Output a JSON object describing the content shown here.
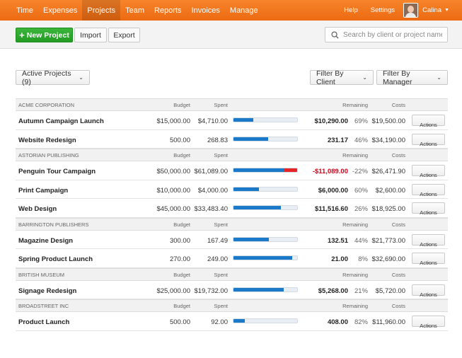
{
  "nav": {
    "items": [
      {
        "label": "Time",
        "active": false
      },
      {
        "label": "Expenses",
        "active": false
      },
      {
        "label": "Projects",
        "active": true
      },
      {
        "label": "Team",
        "active": false
      },
      {
        "label": "Reports",
        "active": false
      },
      {
        "label": "Invoices",
        "active": false
      },
      {
        "label": "Manage",
        "active": false
      }
    ],
    "help": "Help",
    "settings": "Settings",
    "user": "Calina"
  },
  "toolbar": {
    "new_project": "New Project",
    "import": "Import",
    "export": "Export",
    "search_placeholder": "Search by client or project name"
  },
  "filters": {
    "active": "Active Projects (9)",
    "client": "Filter By Client",
    "manager": "Filter By Manager"
  },
  "headers": {
    "budget": "Budget",
    "spent": "Spent",
    "remaining": "Remaining",
    "costs": "Costs"
  },
  "action_label": "Actions",
  "colors": {
    "nav": "#ec6a12",
    "new_button": "#249c24",
    "progress": "#1a7ac9",
    "over_budget": "#e8242b"
  },
  "groups": [
    {
      "client": "Acme Corporation",
      "projects": [
        {
          "name": "Autumn Campaign Launch",
          "budget": "$15,000.00",
          "spent": "$4,710.00",
          "progress": 0.31,
          "over": 0,
          "remaining": "$10,290.00",
          "pct": "69%",
          "costs": "$19,500.00",
          "negative": false
        },
        {
          "name": "Website Redesign",
          "budget": "500.00",
          "spent": "268.83",
          "progress": 0.54,
          "over": 0,
          "remaining": "231.17",
          "pct": "46%",
          "costs": "$34,190.00",
          "negative": false
        }
      ]
    },
    {
      "client": "Astorian Publishing",
      "projects": [
        {
          "name": "Penguin Tour Campaign",
          "budget": "$50,000.00",
          "spent": "$61,089.00",
          "progress": 0.8,
          "over": 0.2,
          "remaining": "-$11,089.00",
          "pct": "-22%",
          "costs": "$26,471.90",
          "negative": true
        },
        {
          "name": "Print Campaign",
          "budget": "$10,000.00",
          "spent": "$4,000.00",
          "progress": 0.4,
          "over": 0,
          "remaining": "$6,000.00",
          "pct": "60%",
          "costs": "$2,600.00",
          "negative": false
        },
        {
          "name": "Web Design",
          "budget": "$45,000.00",
          "spent": "$33,483.40",
          "progress": 0.74,
          "over": 0,
          "remaining": "$11,516.60",
          "pct": "26%",
          "costs": "$18,925.00",
          "negative": false
        }
      ]
    },
    {
      "client": "Barrington Publishers",
      "projects": [
        {
          "name": "Magazine Design",
          "budget": "300.00",
          "spent": "167.49",
          "progress": 0.56,
          "over": 0,
          "remaining": "132.51",
          "pct": "44%",
          "costs": "$21,773.00",
          "negative": false
        },
        {
          "name": "Spring Product Launch",
          "budget": "270.00",
          "spent": "249.00",
          "progress": 0.92,
          "over": 0,
          "remaining": "21.00",
          "pct": "8%",
          "costs": "$32,690.00",
          "negative": false
        }
      ]
    },
    {
      "client": "British Museum",
      "projects": [
        {
          "name": "Signage Redesign",
          "budget": "$25,000.00",
          "spent": "$19,732.00",
          "progress": 0.79,
          "over": 0,
          "remaining": "$5,268.00",
          "pct": "21%",
          "costs": "$5,720.00",
          "negative": false
        }
      ]
    },
    {
      "client": "Broadstreet Inc",
      "projects": [
        {
          "name": "Product Launch",
          "budget": "500.00",
          "spent": "92.00",
          "progress": 0.18,
          "over": 0,
          "remaining": "408.00",
          "pct": "82%",
          "costs": "$11,960.00",
          "negative": false
        }
      ]
    }
  ]
}
